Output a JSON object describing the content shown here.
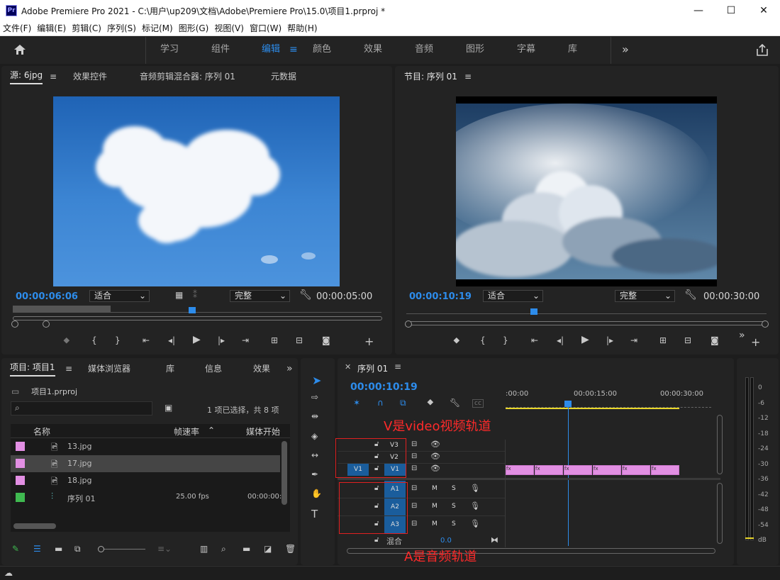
{
  "titlebar": {
    "app_icon": "Pr",
    "title": "Adobe Premiere Pro 2021 - C:\\用户\\up209\\文档\\Adobe\\Premiere Pro\\15.0\\项目1.prproj *",
    "minimize": "—",
    "maximize": "☐",
    "close": "✕"
  },
  "menu": [
    "文件(F)",
    "编辑(E)",
    "剪辑(C)",
    "序列(S)",
    "标记(M)",
    "图形(G)",
    "视图(V)",
    "窗口(W)",
    "帮助(H)"
  ],
  "workspaces": {
    "tabs": [
      "学习",
      "组件",
      "编辑",
      "颜色",
      "效果",
      "音频",
      "图形",
      "字幕",
      "库"
    ],
    "active": "编辑",
    "more": "»"
  },
  "source": {
    "tabs": [
      "源: 6jpg",
      "效果控件",
      "音频剪辑混合器: 序列 01",
      "元数据"
    ],
    "timecode": "00:00:06:06",
    "fit": "适合",
    "quality": "完整",
    "duration": "00:00:05:00"
  },
  "program": {
    "title": "节目: 序列 01",
    "timecode": "00:00:10:19",
    "fit": "适合",
    "quality": "完整",
    "duration": "00:00:30:00"
  },
  "project": {
    "tabs": [
      "项目: 项目1",
      "媒体浏览器",
      "库",
      "信息",
      "效果"
    ],
    "file": "项目1.prproj",
    "selection": "1 项已选择，共 8 项",
    "columns": [
      "名称",
      "帧速率",
      "媒体开始"
    ],
    "items": [
      {
        "name": "13.jpg",
        "rate": "",
        "start": "",
        "color": "#e28fe3"
      },
      {
        "name": "17.jpg",
        "rate": "",
        "start": "",
        "color": "#e28fe3"
      },
      {
        "name": "18.jpg",
        "rate": "",
        "start": "",
        "color": "#e28fe3"
      },
      {
        "name": "序列 01",
        "rate": "25.00 fps",
        "start": "00:00:00:",
        "color": "#3fb950"
      }
    ]
  },
  "timeline": {
    "tab": "序列 01",
    "timecode": "00:00:10:19",
    "ruler": [
      ":00:00",
      "00:00:15:00",
      "00:00:30:00"
    ],
    "video_tracks": [
      "V3",
      "V2",
      "V1"
    ],
    "audio_tracks": [
      "A1",
      "A2",
      "A3"
    ],
    "mix_label": "混合",
    "mix_value": "0.0",
    "clip_label": "fx",
    "source_patch": "V1",
    "m": "M",
    "s": "S"
  },
  "annotations": {
    "video": "V是video视频轨道",
    "audio": "A是音频轨道"
  },
  "meter": {
    "labels": [
      "0",
      "-6",
      "-12",
      "-18",
      "-24",
      "-30",
      "-36",
      "-42",
      "-48",
      "-54",
      "dB"
    ]
  }
}
